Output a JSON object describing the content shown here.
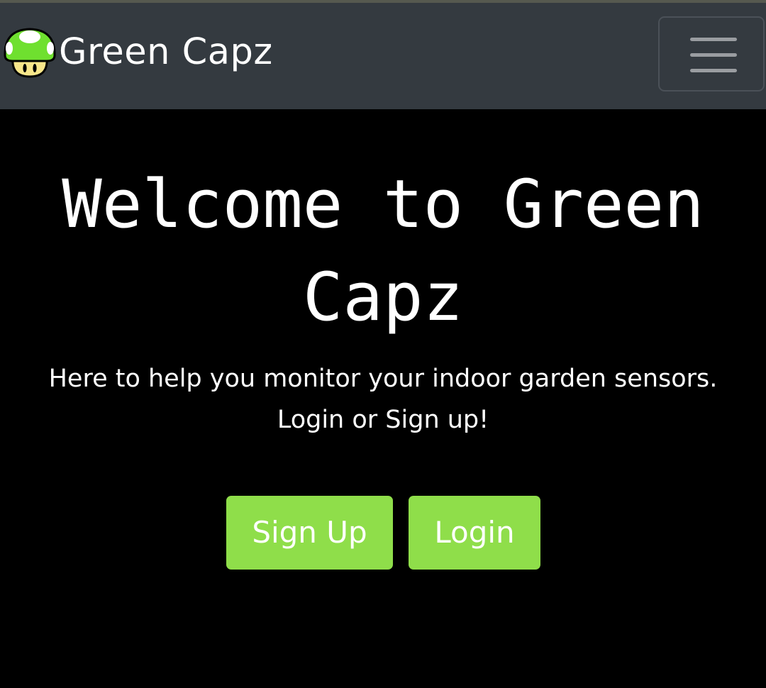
{
  "navbar": {
    "brand_name": "Green Capz",
    "logo_icon": "green-mushroom-icon",
    "menu_icon": "hamburger-menu-icon",
    "background": "#343a40"
  },
  "hero": {
    "title": "Welcome to Green Capz",
    "subtitle_line1": "Here to help you monitor your indoor garden sensors.",
    "subtitle_line2": "Login or Sign up!"
  },
  "buttons": {
    "sign_up_label": "Sign Up",
    "login_label": "Login",
    "color": "#8fde4a"
  },
  "colors": {
    "page_background": "#000000",
    "text": "#ffffff",
    "mushroom_cap": "#6fe02f",
    "mushroom_stem": "#f7e68a"
  }
}
